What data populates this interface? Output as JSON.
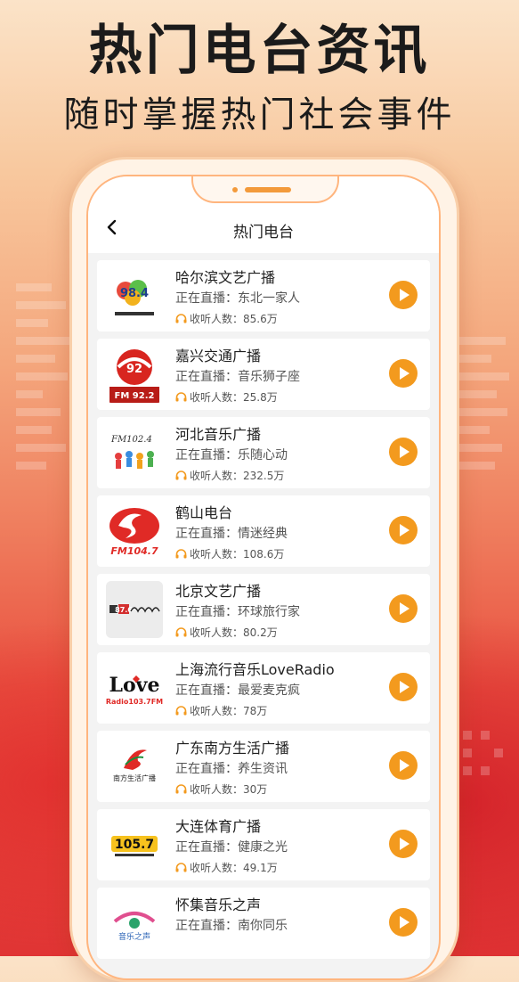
{
  "promo": {
    "headline": "热门电台资讯",
    "subline": "随时掌握热门社会事件"
  },
  "screen": {
    "title": "热门电台",
    "live_prefix": "正在直播：",
    "listeners_prefix": "收听人数：",
    "stations": [
      {
        "name": "哈尔滨文艺广播",
        "program": "东北一家人",
        "listeners": "85.6万",
        "logo": "harbin-arts-radio-logo",
        "logo_text": "98.4"
      },
      {
        "name": "嘉兴交通广播",
        "program": "音乐狮子座",
        "listeners": "25.8万",
        "logo": "jiaxing-traffic-radio-logo",
        "logo_text": "FM 92.2"
      },
      {
        "name": "河北音乐广播",
        "program": "乐随心动",
        "listeners": "232.5万",
        "logo": "hebei-music-radio-logo",
        "logo_text": "FM102.4"
      },
      {
        "name": "鹤山电台",
        "program": "情迷经典",
        "listeners": "108.6万",
        "logo": "heshan-radio-logo",
        "logo_text": "FM104.7"
      },
      {
        "name": "北京文艺广播",
        "program": "环球旅行家",
        "listeners": "80.2万",
        "logo": "beijing-arts-radio-logo",
        "logo_text": "87.6"
      },
      {
        "name": "上海流行音乐LoveRadio",
        "program": "最爱麦克疯",
        "listeners": "78万",
        "logo": "shanghai-love-radio-logo",
        "logo_text": "Love"
      },
      {
        "name": "广东南方生活广播",
        "program": "养生资讯",
        "listeners": "30万",
        "logo": "guangdong-south-life-radio-logo",
        "logo_text": "南方生活广播"
      },
      {
        "name": "大连体育广播",
        "program": "健康之光",
        "listeners": "49.1万",
        "logo": "dalian-sports-radio-logo",
        "logo_text": "105.7"
      },
      {
        "name": "怀集音乐之声",
        "program": "南你同乐",
        "listeners": "",
        "logo": "huaiji-music-radio-logo",
        "logo_text": "音乐之声"
      }
    ]
  },
  "colors": {
    "accent": "#f39a1e",
    "phone_border": "#ffb57e",
    "background_top": "#fbe3c8",
    "background_bottom": "#e03434"
  }
}
